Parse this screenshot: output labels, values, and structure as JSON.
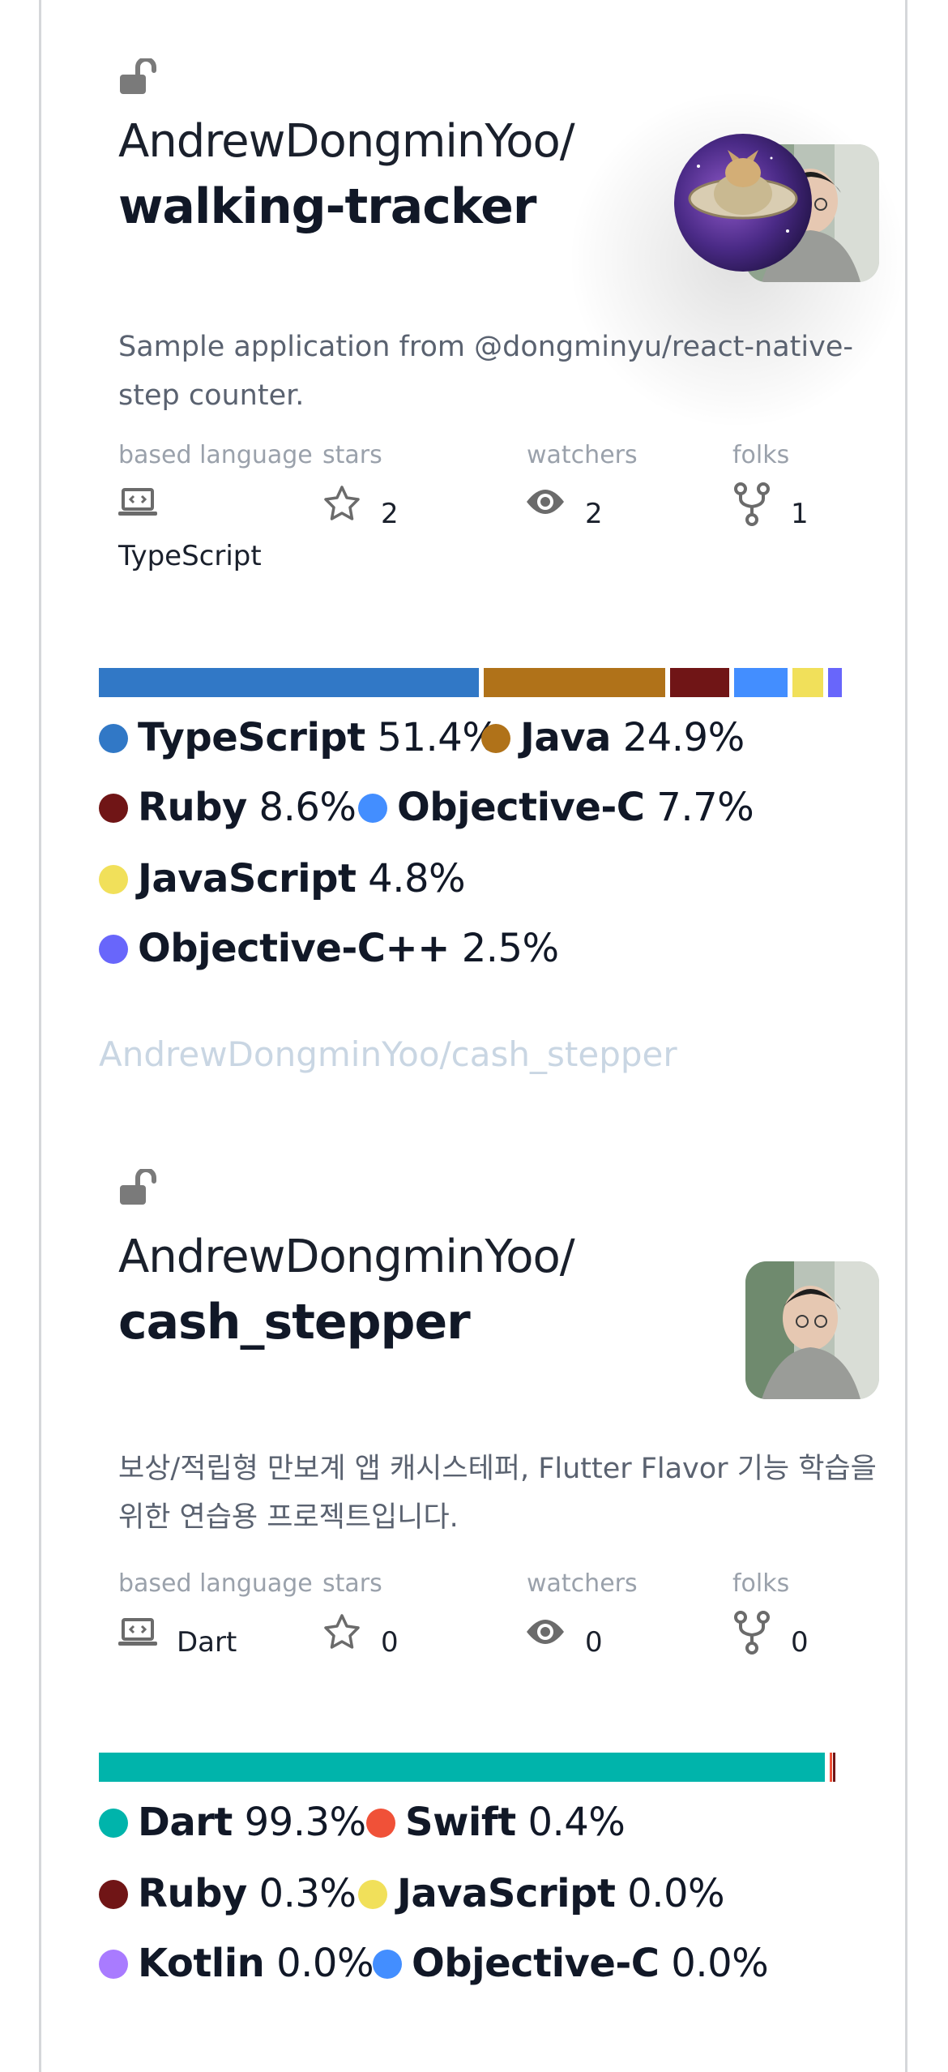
{
  "repos": [
    {
      "owner": "AndrewDongminYoo/",
      "name": "walking-tracker",
      "description": "Sample application from @dongminyu/react-native-step counter.",
      "stats": {
        "language_label": "based language",
        "language_value": "TypeScript",
        "stars_label": "stars",
        "stars_value": "2",
        "watchers_label": "watchers",
        "watchers_value": "2",
        "forks_label": "folks",
        "forks_value": "1"
      },
      "languages": [
        {
          "name": "TypeScript",
          "percent": "51.4%",
          "color": "#3178c6"
        },
        {
          "name": "Java",
          "percent": "24.9%",
          "color": "#b07219"
        },
        {
          "name": "Ruby",
          "percent": "8.6%",
          "color": "#701516"
        },
        {
          "name": "Objective-C",
          "percent": "7.7%",
          "color": "#438eff"
        },
        {
          "name": "JavaScript",
          "percent": "4.8%",
          "color": "#f1e05a"
        },
        {
          "name": "Objective-C++",
          "percent": "2.5%",
          "color": "#6866fb"
        }
      ]
    },
    {
      "link_text": "AndrewDongminYoo/cash_stepper",
      "owner": "AndrewDongminYoo/",
      "name": "cash_stepper",
      "description": "보상/적립형 만보계 앱 캐시스테퍼, Flutter Flavor 기능 학습을 위한 연습용 프로젝트입니다.",
      "stats": {
        "language_label": "based language",
        "language_value": "Dart",
        "stars_label": "stars",
        "stars_value": "0",
        "watchers_label": "watchers",
        "watchers_value": "0",
        "forks_label": "folks",
        "forks_value": "0"
      },
      "languages": [
        {
          "name": "Dart",
          "percent": "99.3%",
          "color": "#00b4ab"
        },
        {
          "name": "Swift",
          "percent": "0.4%",
          "color": "#f05138"
        },
        {
          "name": "Ruby",
          "percent": "0.3%",
          "color": "#701516"
        },
        {
          "name": "JavaScript",
          "percent": "0.0%",
          "color": "#f1e05a"
        },
        {
          "name": "Kotlin",
          "percent": "0.0%",
          "color": "#a97bff"
        },
        {
          "name": "Objective-C",
          "percent": "0.0%",
          "color": "#438eff"
        }
      ]
    }
  ]
}
